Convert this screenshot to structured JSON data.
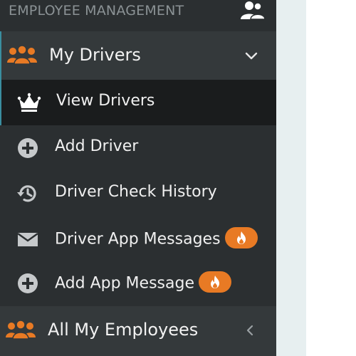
{
  "colors": {
    "sidebar_bg": "#2b2f31",
    "group_bg": "#34393b",
    "current_item_bg": "#1a1c1d",
    "accent_orange": "#e87a24",
    "active_border": "#3a8ea0",
    "section_title": "#8b9295"
  },
  "section": {
    "title": "EMPLOYEE MANAGEMENT",
    "icon": "users-icon"
  },
  "groups": [
    {
      "label": "My Drivers",
      "icon": "users-icon",
      "chevron": "chevron-down-icon",
      "expanded": true,
      "items": [
        {
          "label": "View Drivers",
          "icon": "crown-icon",
          "current": true
        },
        {
          "label": "Add Driver",
          "icon": "plus-circle-icon"
        },
        {
          "label": "Driver Check History",
          "icon": "history-icon"
        },
        {
          "label": "Driver App Messages",
          "icon": "envelope-icon",
          "badge": "fire-icon"
        },
        {
          "label": "Add App Message",
          "icon": "plus-circle-icon",
          "badge": "fire-icon"
        }
      ]
    },
    {
      "label": "All My Employees",
      "icon": "users-icon",
      "chevron": "chevron-left-icon",
      "expanded": false
    }
  ]
}
